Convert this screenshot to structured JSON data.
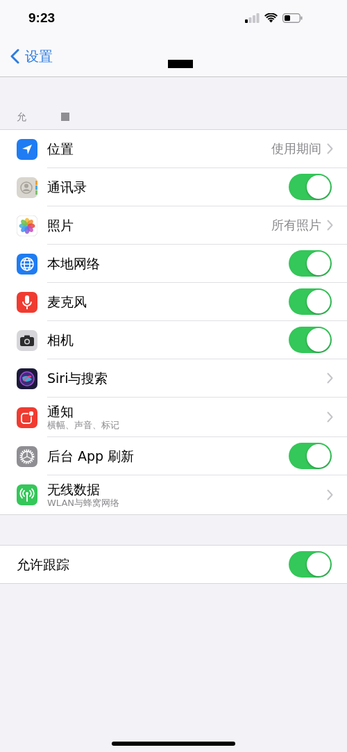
{
  "status_bar": {
    "time": "9:23"
  },
  "nav": {
    "back": "设置"
  },
  "section_header": "允",
  "rows": [
    {
      "kind": "link",
      "title": "位置",
      "value": "使用期间"
    },
    {
      "kind": "toggle",
      "title": "通讯录",
      "on": true
    },
    {
      "kind": "link",
      "title": "照片",
      "value": "所有照片"
    },
    {
      "kind": "toggle",
      "title": "本地网络",
      "on": true
    },
    {
      "kind": "toggle",
      "title": "麦克风",
      "on": true
    },
    {
      "kind": "toggle",
      "title": "相机",
      "on": true
    },
    {
      "kind": "link",
      "title": "Siri与搜索"
    },
    {
      "kind": "link",
      "title": "通知",
      "subtitle": "横幅、声音、标记"
    },
    {
      "kind": "toggle",
      "title": "后台 App 刷新",
      "on": true
    },
    {
      "kind": "link",
      "title": "无线数据",
      "subtitle": "WLAN与蜂窝网络"
    }
  ],
  "tracking": [
    {
      "kind": "toggle",
      "title": "允许跟踪",
      "on": true
    }
  ]
}
